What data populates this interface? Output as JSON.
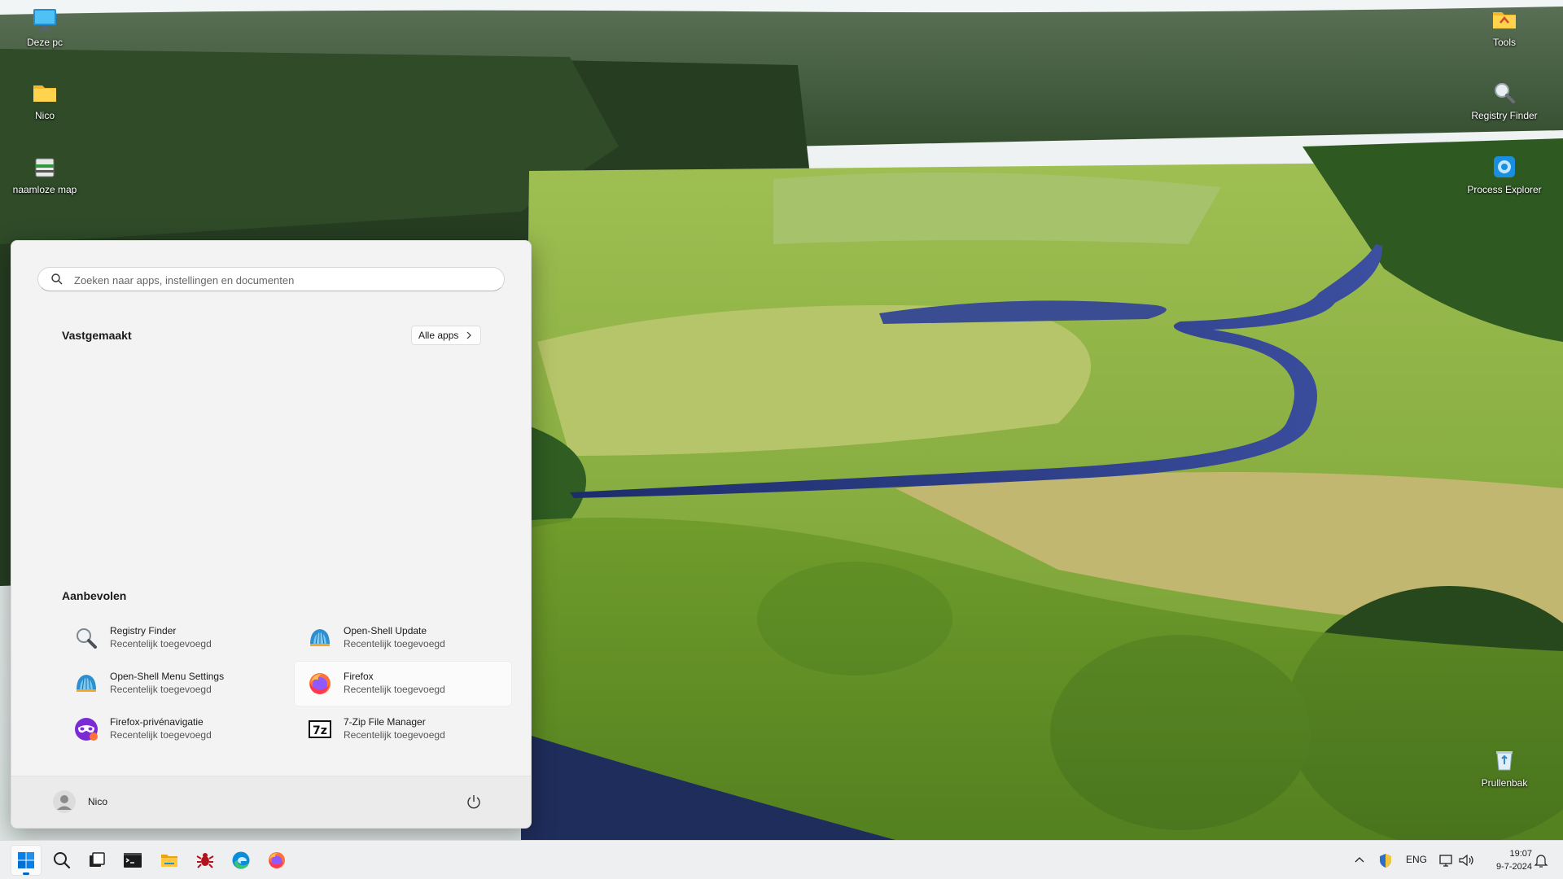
{
  "desktop": {
    "icons_left": [
      {
        "label": "Deze pc",
        "icon": "monitor-icon"
      },
      {
        "label": "Nico",
        "icon": "folder-icon"
      },
      {
        "label": "naamloze map",
        "icon": "cabinet-icon"
      }
    ],
    "icons_right": [
      {
        "label": "Tools",
        "icon": "folder-tools-icon"
      },
      {
        "label": "Registry Finder",
        "icon": "magnifier-icon"
      },
      {
        "label": "Process Explorer",
        "icon": "process-explorer-icon"
      },
      {
        "label": "Prullenbak",
        "icon": "recycle-bin-icon"
      }
    ]
  },
  "start_menu": {
    "search": {
      "placeholder": "Zoeken naar apps, instellingen en documenten"
    },
    "pinned": {
      "title": "Vastgemaakt",
      "all_apps_label": "Alle apps"
    },
    "recommended": {
      "title": "Aanbevolen",
      "items": [
        {
          "name": "Registry Finder",
          "subtitle": "Recentelijk toegevoegd",
          "icon": "magnifier-icon"
        },
        {
          "name": "Open-Shell Update",
          "subtitle": "Recentelijk toegevoegd",
          "icon": "shell-icon"
        },
        {
          "name": "Open-Shell Menu Settings",
          "subtitle": "Recentelijk toegevoegd",
          "icon": "shell-icon"
        },
        {
          "name": "Firefox",
          "subtitle": "Recentelijk toegevoegd",
          "icon": "firefox-icon"
        },
        {
          "name": "Firefox-privénavigatie",
          "subtitle": "Recentelijk toegevoegd",
          "icon": "firefox-private-icon"
        },
        {
          "name": "7-Zip File Manager",
          "subtitle": "Recentelijk toegevoegd",
          "icon": "7zip-icon"
        }
      ]
    },
    "user": {
      "name": "Nico"
    }
  },
  "taskbar": {
    "apps": [
      "windows-start-icon",
      "search-icon",
      "task-view-icon",
      "terminal-icon",
      "file-explorer-icon",
      "bug-app-icon",
      "edge-icon",
      "firefox-icon"
    ],
    "tray": {
      "language": "ENG",
      "time": "19:07",
      "date": "9-7-2024"
    }
  },
  "colors": {
    "accent": "#0067c0",
    "start_bg": "#f3f3f3",
    "taskbar_bg": "#eeeff1"
  }
}
